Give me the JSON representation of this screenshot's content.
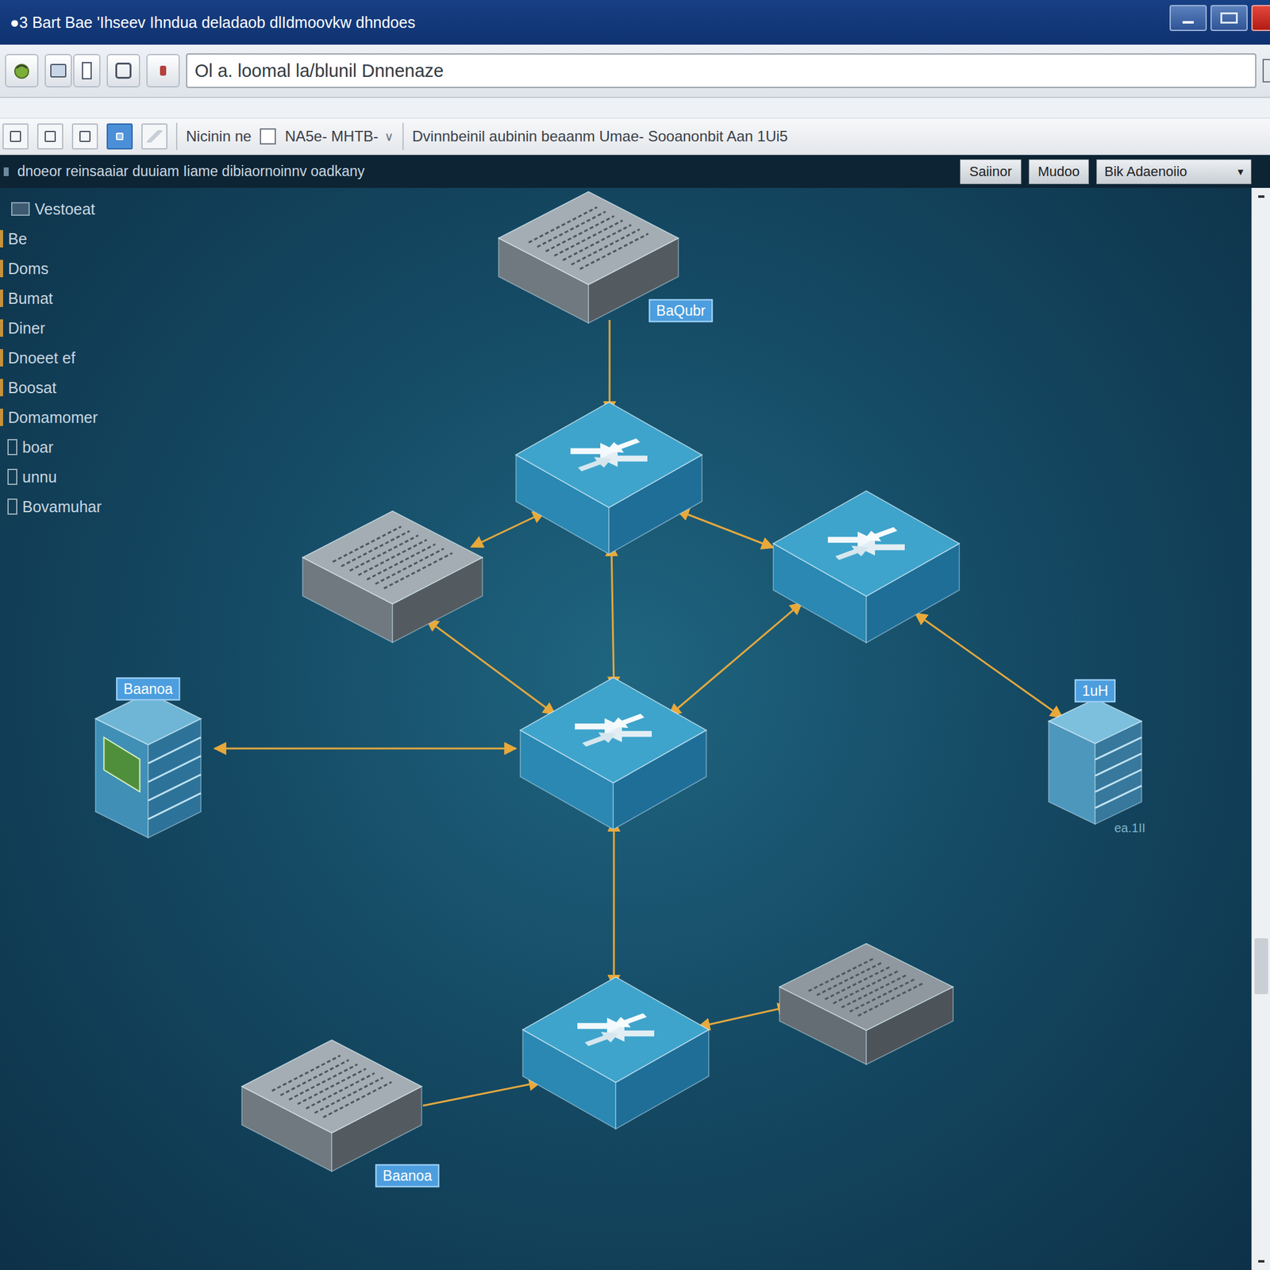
{
  "window": {
    "title": "●3 Bart Bae 'Ihseev Ihndua deladaob dlIdmoovkw dhndoes"
  },
  "address": {
    "value": "Ol a. loomal la/blunil Dnnenaze"
  },
  "toolbar": {
    "tools": [
      {
        "selected": false
      },
      {
        "selected": false
      },
      {
        "selected": false
      },
      {
        "selected": true
      },
      {
        "selected": false
      }
    ],
    "label": "Nicinin ne",
    "checkbox": {
      "checked": false
    },
    "dropdown": "NA5e- MHTB-",
    "caret": "∨",
    "info": "Dvinnbeinil aubinin beaanm Umae- Sooanonbit Aan 1Ui5"
  },
  "strip": {
    "text": "dnoeor reinsaaiar duuiam Iiame dibiaornoinnv oadkany",
    "buttons": [
      "Saiinor",
      "Mudoo"
    ],
    "dropdown": "Bik Adaenoiio",
    "caret": "▾"
  },
  "sidebar": {
    "items": [
      {
        "label": "Vestoeat",
        "kind": "group"
      },
      {
        "label": "Be",
        "kind": "folder"
      },
      {
        "label": "Doms",
        "kind": "folder"
      },
      {
        "label": "Bumat",
        "kind": "folder"
      },
      {
        "label": "Diner",
        "kind": "folder"
      },
      {
        "label": "Dnoeet ef",
        "kind": "folder"
      },
      {
        "label": "Boosat",
        "kind": "folder"
      },
      {
        "label": "Domamomer",
        "kind": "folder"
      },
      {
        "label": "boar",
        "kind": "file"
      },
      {
        "label": "unnu",
        "kind": "file"
      },
      {
        "label": "Bovamuhar",
        "kind": "file"
      }
    ]
  },
  "diagram": {
    "nodes": [
      {
        "kind": "server",
        "label": "BaQubr"
      },
      {
        "kind": "switch"
      },
      {
        "kind": "server"
      },
      {
        "kind": "switch"
      },
      {
        "kind": "switch"
      },
      {
        "kind": "device",
        "label": "Baanoa"
      },
      {
        "kind": "building",
        "label": "1uH",
        "tag": "ea.1II"
      },
      {
        "kind": "switch"
      },
      {
        "kind": "appliance"
      },
      {
        "kind": "server",
        "label": "Baanoa"
      }
    ]
  }
}
